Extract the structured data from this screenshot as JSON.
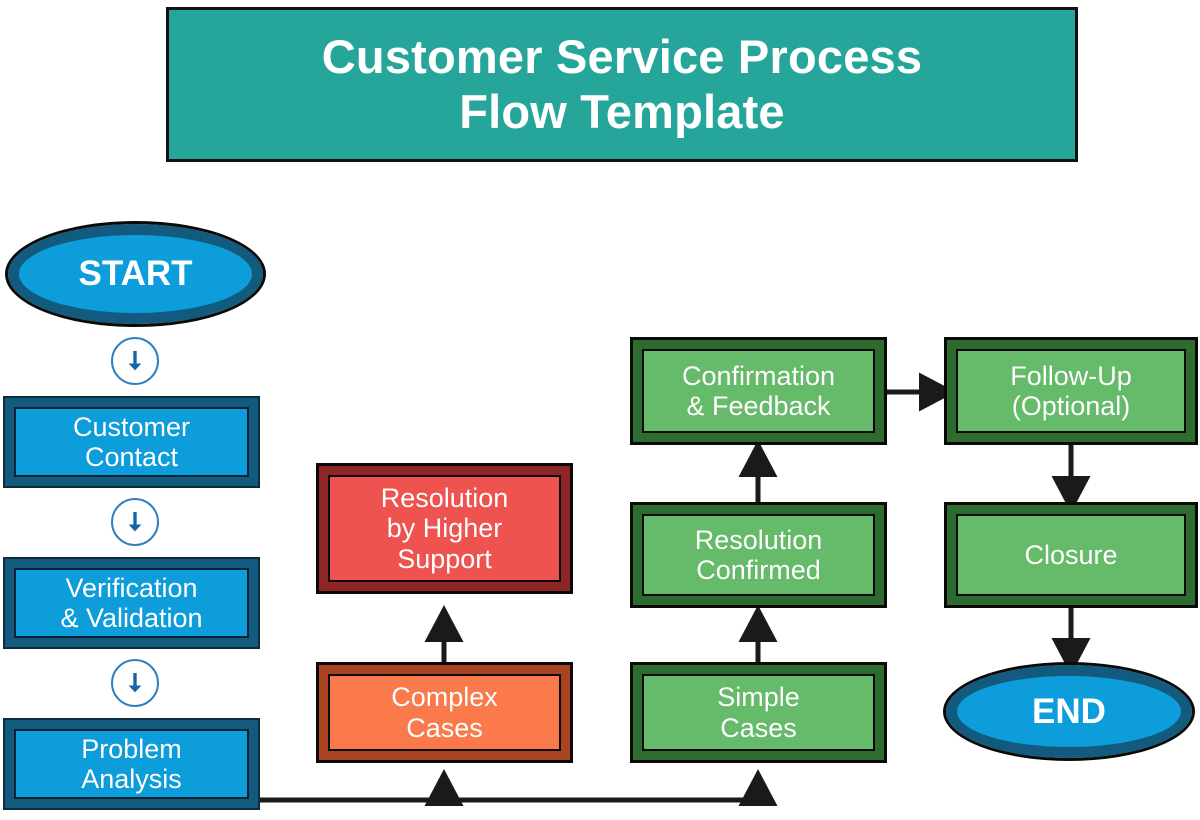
{
  "banner": {
    "title": "Customer Service Process\nFlow Template",
    "background_color": "#26a69a",
    "text_color": "#ffffff",
    "border_color": "#111111"
  },
  "colors": {
    "teal_header": "#26a69a",
    "blue_fill": "#0d9ddb",
    "blue_border": "#135b7e",
    "green_fill": "#66bb6a",
    "green_border": "#2e6b2e",
    "red_fill": "#ef5350",
    "red_border": "#8e2626",
    "orange_fill": "#fb7a4b",
    "orange_border": "#a8441f",
    "connector_arrow": "#1a1a1a",
    "circle_arrow_outline": "#2f7fc1"
  },
  "nodes": {
    "start": {
      "label": "START",
      "shape": "oval",
      "color": "blue"
    },
    "customer_contact": {
      "label": "Customer\nContact",
      "shape": "rect",
      "color": "blue"
    },
    "verification_validation": {
      "label": "Verification\n& Validation",
      "shape": "rect",
      "color": "blue"
    },
    "problem_analysis": {
      "label": "Problem\nAnalysis",
      "shape": "rect",
      "color": "blue"
    },
    "complex_cases": {
      "label": "Complex\nCases",
      "shape": "rect",
      "color": "orange"
    },
    "resolution_higher_support": {
      "label": "Resolution\nby Higher\nSupport",
      "shape": "rect",
      "color": "red"
    },
    "simple_cases": {
      "label": "Simple\nCases",
      "shape": "rect",
      "color": "green"
    },
    "resolution_confirmed": {
      "label": "Resolution\nConfirmed",
      "shape": "rect",
      "color": "green"
    },
    "confirmation_feedback": {
      "label": "Confirmation\n& Feedback",
      "shape": "rect",
      "color": "green"
    },
    "follow_up": {
      "label": "Follow-Up\n(Optional)",
      "shape": "rect",
      "color": "green"
    },
    "closure": {
      "label": "Closure",
      "shape": "rect",
      "color": "green"
    },
    "end": {
      "label": "END",
      "shape": "oval",
      "color": "blue"
    }
  },
  "connectors": [
    {
      "from": "start",
      "to": "customer_contact",
      "style": "circle-arrow-down",
      "icon": "arrow-down-icon"
    },
    {
      "from": "customer_contact",
      "to": "verification_validation",
      "style": "circle-arrow-down",
      "icon": "arrow-down-icon"
    },
    {
      "from": "verification_validation",
      "to": "problem_analysis",
      "style": "circle-arrow-down",
      "icon": "arrow-down-icon"
    },
    {
      "from": "problem_analysis",
      "to": "complex_cases",
      "style": "elbow-up-arrow"
    },
    {
      "from": "problem_analysis",
      "to": "simple_cases",
      "style": "elbow-up-arrow"
    },
    {
      "from": "complex_cases",
      "to": "resolution_higher_support",
      "style": "straight-up-arrow"
    },
    {
      "from": "simple_cases",
      "to": "resolution_confirmed",
      "style": "straight-up-arrow"
    },
    {
      "from": "resolution_confirmed",
      "to": "confirmation_feedback",
      "style": "straight-up-arrow"
    },
    {
      "from": "confirmation_feedback",
      "to": "follow_up",
      "style": "straight-right-arrow"
    },
    {
      "from": "follow_up",
      "to": "closure",
      "style": "straight-down-arrow"
    },
    {
      "from": "closure",
      "to": "end",
      "style": "straight-down-arrow"
    }
  ]
}
